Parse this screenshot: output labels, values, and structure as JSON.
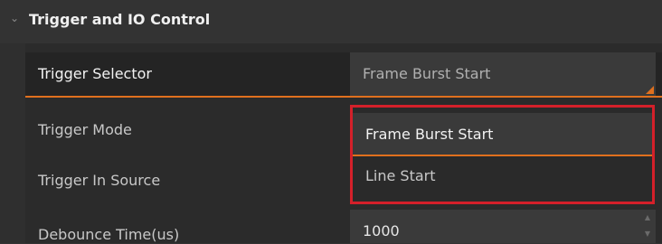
{
  "section": {
    "title": "Trigger and IO Control",
    "expanded_icon": "chevron-down-icon"
  },
  "rows": [
    {
      "label": "Trigger Selector",
      "value": "Frame Burst Start"
    },
    {
      "label": "Trigger Mode"
    },
    {
      "label": "Trigger In Source"
    },
    {
      "label": "Debounce Time(us)",
      "value": "1000"
    }
  ],
  "dropdown": {
    "options": [
      "Frame Burst Start",
      "Line Start"
    ],
    "highlighted": "Frame Burst Start"
  },
  "colors": {
    "accent": "#e0701e",
    "highlight_border": "#d4202a",
    "background": "#2b2b2b"
  }
}
